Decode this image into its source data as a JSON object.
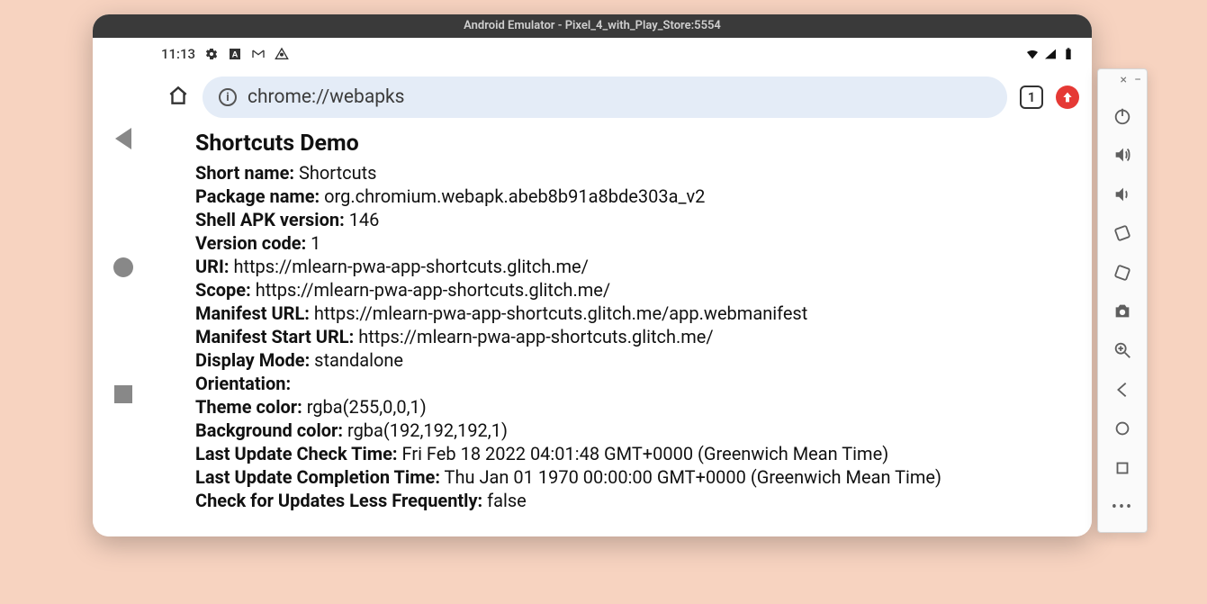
{
  "window": {
    "title": "Android Emulator - Pixel_4_with_Play_Store:5554"
  },
  "statusbar": {
    "time": "11:13"
  },
  "omnibar": {
    "url": "chrome://webapks",
    "tab_count": "1"
  },
  "page": {
    "title": "Shortcuts Demo",
    "fields": [
      {
        "label": "Short name:",
        "value": "Shortcuts"
      },
      {
        "label": "Package name:",
        "value": "org.chromium.webapk.abeb8b91a8bde303a_v2"
      },
      {
        "label": "Shell APK version:",
        "value": "146"
      },
      {
        "label": "Version code:",
        "value": "1"
      },
      {
        "label": "URI:",
        "value": "https://mlearn-pwa-app-shortcuts.glitch.me/"
      },
      {
        "label": "Scope:",
        "value": "https://mlearn-pwa-app-shortcuts.glitch.me/"
      },
      {
        "label": "Manifest URL:",
        "value": "https://mlearn-pwa-app-shortcuts.glitch.me/app.webmanifest"
      },
      {
        "label": "Manifest Start URL:",
        "value": "https://mlearn-pwa-app-shortcuts.glitch.me/"
      },
      {
        "label": "Display Mode:",
        "value": "standalone"
      },
      {
        "label": "Orientation:",
        "value": ""
      },
      {
        "label": "Theme color:",
        "value": "rgba(255,0,0,1)"
      },
      {
        "label": "Background color:",
        "value": "rgba(192,192,192,1)"
      },
      {
        "label": "Last Update Check Time:",
        "value": "Fri Feb 18 2022 04:01:48 GMT+0000 (Greenwich Mean Time)"
      },
      {
        "label": "Last Update Completion Time:",
        "value": "Thu Jan 01 1970 00:00:00 GMT+0000 (Greenwich Mean Time)"
      },
      {
        "label": "Check for Updates Less Frequently:",
        "value": "false"
      }
    ]
  }
}
